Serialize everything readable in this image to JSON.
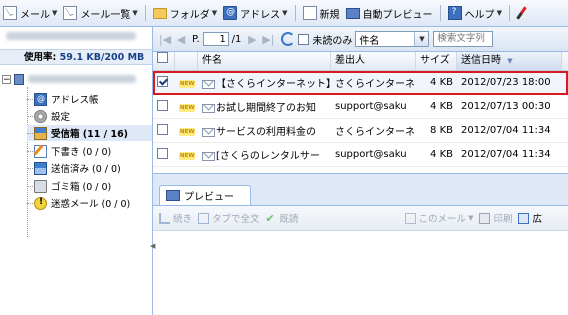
{
  "toolbar": {
    "mail": "メール",
    "mail_list": "メール一覧",
    "folder": "フォルダ",
    "address": "アドレス",
    "new": "新規",
    "auto_preview": "自動プレビュー",
    "help": "ヘルプ"
  },
  "sidebar": {
    "usage_label": "使用率:",
    "usage_value": "59.1 KB/200 MB",
    "items": [
      {
        "label": "アドレス帳",
        "icon": "address-book-icon"
      },
      {
        "label": "設定",
        "icon": "gear-icon"
      },
      {
        "label": "受信箱 (11 / 16)",
        "icon": "inbox-icon"
      },
      {
        "label": "下書き (0 / 0)",
        "icon": "draft-icon"
      },
      {
        "label": "送信済み (0 / 0)",
        "icon": "sent-icon"
      },
      {
        "label": "ゴミ箱 (0 / 0)",
        "icon": "trash-icon"
      },
      {
        "label": "迷惑メール (0 / 0)",
        "icon": "spam-icon"
      }
    ]
  },
  "grid_toolbar": {
    "page_label": "P.",
    "page_value": "1",
    "page_total": "/1",
    "unread_only": "未読のみ",
    "field_select": "件名",
    "search_placeholder": "検索文字列"
  },
  "grid": {
    "columns": [
      "件名",
      "差出人",
      "サイズ",
      "送信日時"
    ],
    "new_badge": "NEW",
    "rows": [
      {
        "subject": "【さくらインターネット】さ",
        "from": "さくらインターネ",
        "size": "4 KB",
        "date": "2012/07/23 18:00",
        "selected": true
      },
      {
        "subject": "お試し期間終了のお知",
        "from": "support@saku",
        "size": "4 KB",
        "date": "2012/07/13 00:30",
        "selected": false
      },
      {
        "subject": "サービスの利用料金の",
        "from": "さくらインターネ",
        "size": "8 KB",
        "date": "2012/07/04 11:34",
        "selected": false
      },
      {
        "subject": "[さくらのレンタルサー",
        "from": "support@saku",
        "size": "4 KB",
        "date": "2012/07/04 11:34",
        "selected": false
      }
    ]
  },
  "preview": {
    "tab": "プレビュー",
    "continue": "続き",
    "tab_full": "タブで全文",
    "read": "既読",
    "this_mail": "このメール",
    "print": "印刷",
    "more": "広"
  },
  "colors": {
    "selection_outline": "#d71920",
    "panel_border": "#99bbe8",
    "toolbar_bg": "#dfe8f6"
  }
}
